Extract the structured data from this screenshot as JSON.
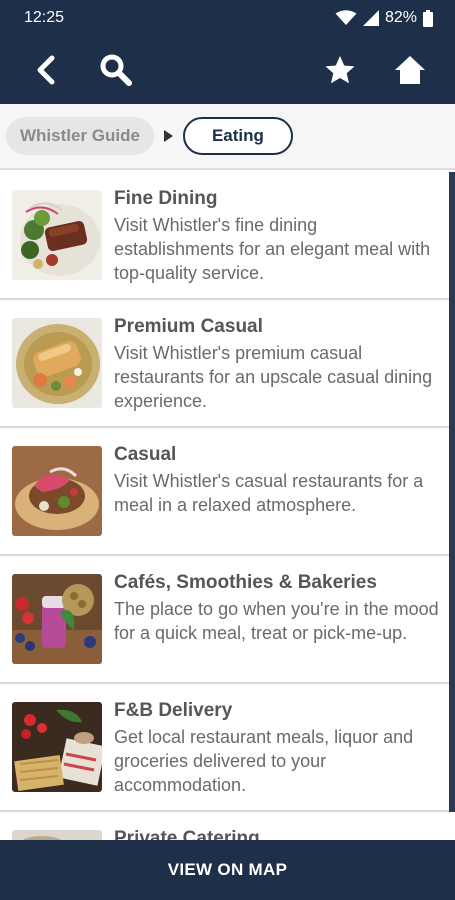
{
  "status_bar": {
    "time": "12:25",
    "battery": "82%"
  },
  "app_bar": {
    "icons": [
      "back-icon",
      "search-icon",
      "star-icon",
      "home-icon"
    ]
  },
  "breadcrumb": {
    "root": "Whistler Guide",
    "current": "Eating"
  },
  "items": [
    {
      "title": "Fine Dining",
      "description": "Visit Whistler's fine dining establishments for an elegant meal with top-quality service."
    },
    {
      "title": "Premium Casual",
      "description": "Visit Whistler's premium casual restaurants for an upscale casual dining experience."
    },
    {
      "title": "Casual",
      "description": "Visit Whistler's casual restaurants for a meal in a relaxed atmosphere."
    },
    {
      "title": "Cafés, Smoothies & Bakeries",
      "description": "The place to go when you're in the mood for a quick meal, treat or pick-me-up."
    },
    {
      "title": "F&B Delivery",
      "description": "Get local restaurant meals, liquor and groceries delivered to your accommodation."
    },
    {
      "title": "Private Catering",
      "description": ""
    }
  ],
  "bottom_bar": {
    "label": "VIEW ON MAP"
  },
  "colors": {
    "primary": "#1e2f4a",
    "text_title": "#555555",
    "text_desc": "#6a6a6a"
  }
}
